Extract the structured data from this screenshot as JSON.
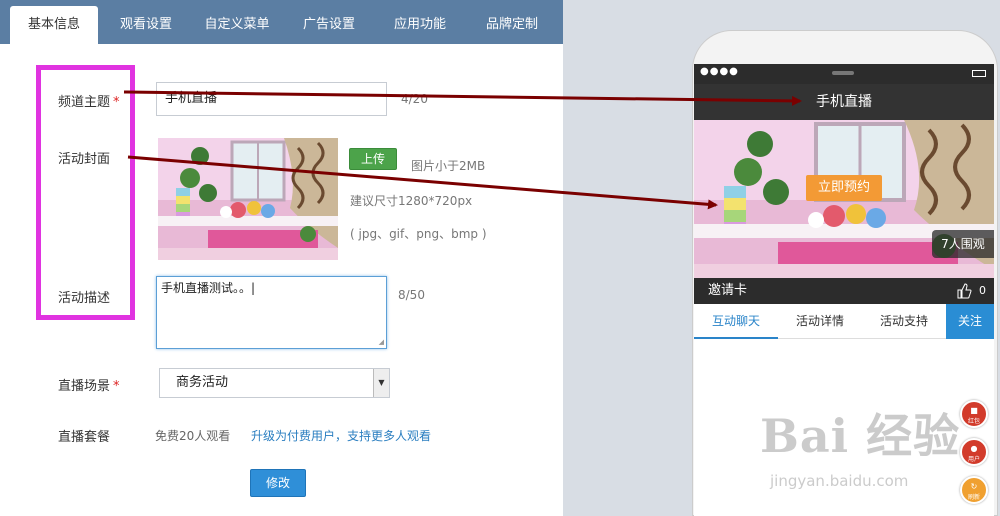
{
  "tabs": [
    "基本信息",
    "观看设置",
    "自定义菜单",
    "广告设置",
    "应用功能",
    "品牌定制"
  ],
  "form": {
    "title_label": "频道主题",
    "required_mark": "*",
    "title_value": "手机直播",
    "title_count": "4/20",
    "cover_label": "活动封面",
    "upload_label": "上传",
    "hint_size": "图片小于2MB",
    "hint_dimensions": "建议尺寸1280*720px",
    "hint_formats": "( jpg、gif、png、bmp )",
    "desc_label": "活动描述",
    "desc_value": "手机直播测试。。|",
    "desc_count": "8/50",
    "scene_label": "直播场景",
    "scene_value": "商务活动",
    "package_label": "直播套餐",
    "package_value": "免费20人观看",
    "upgrade_link": "升级为付费用户，支持更多人观看",
    "modify_label": "修改"
  },
  "phone": {
    "title": "手机直播",
    "reserve_label": "立即预约",
    "viewers": "7人围观",
    "invite": "邀请卡",
    "likes": "0",
    "tabs": [
      "互动聊天",
      "活动详情",
      "活动支持"
    ],
    "follow_label": "关注",
    "fab_labels": [
      "红包",
      "用户",
      "刷新"
    ]
  },
  "watermark": {
    "logo": "Bai 经验",
    "url": "jingyan.baidu.com"
  },
  "colors": {
    "tab_bar": "#5b7ea3",
    "highlight": "#e033e0",
    "arrow": "#7a0000",
    "upload": "#4ca34a",
    "modify": "#2f8fd8",
    "follow": "#2a8dd4",
    "reserve": "#f39a35",
    "fab": "#d23b2b"
  }
}
